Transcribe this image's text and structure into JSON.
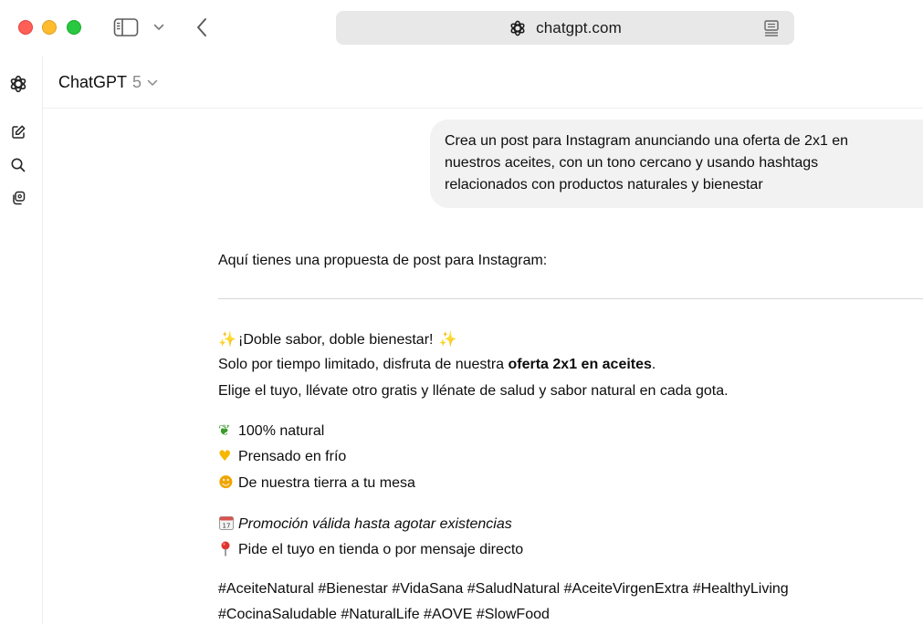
{
  "browser": {
    "url": "chatgpt.com"
  },
  "header": {
    "model_name": "ChatGPT",
    "model_version": "5"
  },
  "user_message": {
    "lines": [
      "Crea un post para Instagram anunciando una oferta de 2x1 en",
      "nuestros aceites, con un tono cercano y usando hashtags",
      "relacionados con productos naturales y bienestar"
    ]
  },
  "assistant": {
    "intro": "Aquí tienes una propuesta de post para Instagram:",
    "headline": "¡Doble sabor, doble bienestar!",
    "offer_prefix": "Solo por tiempo limitado, disfruta de nuestra ",
    "offer_bold": "oferta 2x1 en aceites",
    "offer_suffix": ".",
    "choose_line": "Elige el tuyo, llévate otro gratis y llénate de salud y sabor natural en cada gota.",
    "features": [
      {
        "icon": "herb-icon",
        "text": "100% natural"
      },
      {
        "icon": "yellow-heart-icon",
        "text": "Prensado en frío"
      },
      {
        "icon": "smiling-face-icon",
        "text": "De nuestra tierra a tu mesa"
      }
    ],
    "promo_validity": "Promoción válida hasta agotar existencias",
    "order_line": "Pide el tuyo en tienda o por mensaje directo",
    "hashtags_line1": "#AceiteNatural #Bienestar #VidaSana #SaludNatural #AceiteVirgenExtra #HealthyLiving",
    "hashtags_line2": "#CocinaSaludable #NaturalLife #AOVE #SlowFood"
  },
  "colors": {
    "traffic_red": "#ff5f57",
    "traffic_yellow": "#febc2e",
    "traffic_green": "#28c840",
    "bubble_bg": "#f2f2f2",
    "address_bg": "#e8e8e8"
  }
}
